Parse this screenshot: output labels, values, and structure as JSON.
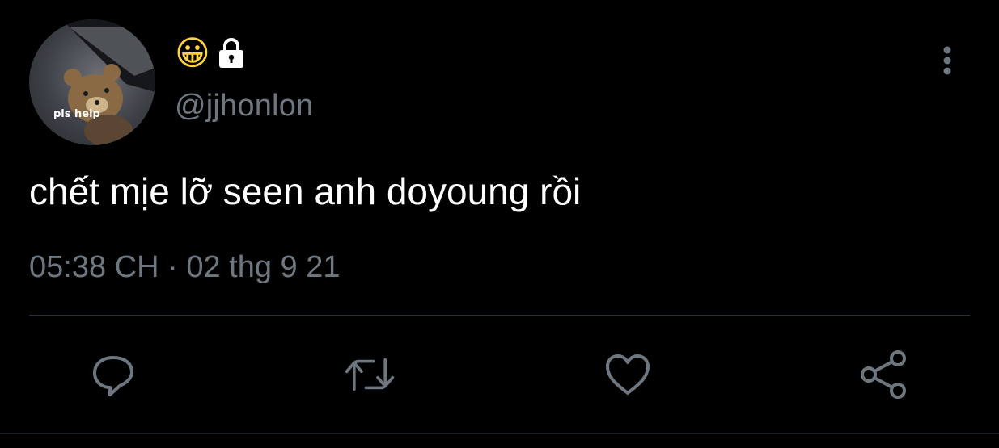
{
  "author": {
    "avatar_caption": "pls help",
    "display_name_emoji": "😀",
    "locked": true,
    "handle": "@jjhonlon"
  },
  "tweet": {
    "text": "chết mịe lỡ seen anh doyoung rồi",
    "time": "05:38 CH",
    "separator": "·",
    "date": "02 thg 9 21"
  },
  "actions": {
    "reply_icon": "reply-icon",
    "retweet_icon": "retweet-icon",
    "like_icon": "heart-icon",
    "share_icon": "share-icon"
  },
  "colors": {
    "background": "#000000",
    "text_primary": "#ffffff",
    "text_secondary": "#6e7780",
    "icon": "#6e7780",
    "divider": "#2b3036"
  }
}
